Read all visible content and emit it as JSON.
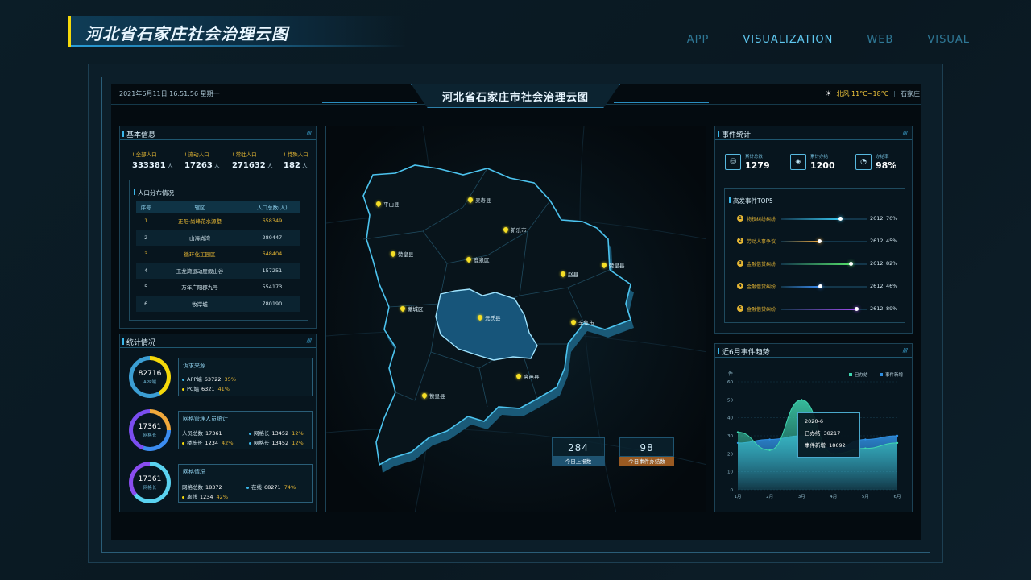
{
  "header": {
    "title": "河北省石家庄社会治理云图",
    "nav": [
      "APP",
      "VISUALIZATION",
      "WEB",
      "VISUAL"
    ],
    "active_nav": "VISUALIZATION"
  },
  "screen": {
    "datetime": "2021年6月11日  16:51:56   星期一",
    "title": "河北省石家庄市社会治理云图",
    "weather": "北风 11°C~18°C",
    "city": "石家庄"
  },
  "basic_info": {
    "title": "基本信息",
    "stats": [
      {
        "label": "全部人口",
        "value": "333381",
        "unit": "人"
      },
      {
        "label": "流动人口",
        "value": "17263",
        "unit": "人"
      },
      {
        "label": "常驻人口",
        "value": "271632",
        "unit": "人"
      },
      {
        "label": "特殊人口",
        "value": "182",
        "unit": "人"
      }
    ],
    "distribution": {
      "title": "人口分布情况",
      "headers": [
        "序号",
        "辖区",
        "人口总数(人)"
      ],
      "rows": [
        [
          "1",
          "正阳·尚峰花水源墅",
          "658349"
        ],
        [
          "2",
          "山海尚湾",
          "280447"
        ],
        [
          "3",
          "循环化工园区",
          "648404"
        ],
        [
          "4",
          "玉龙湾运动度假山谷",
          "157251"
        ],
        [
          "5",
          "万年广阳郡九号",
          "554173"
        ],
        [
          "6",
          "牧岸城",
          "780190"
        ]
      ]
    }
  },
  "stats_panel": {
    "title": "统计情况",
    "groups": [
      {
        "ring_value": "82716",
        "ring_label": "APP端",
        "box_title": "诉求来源",
        "lines": [
          {
            "label": "APP端",
            "value": "63722",
            "pct": "35%"
          },
          {
            "label": "PC端",
            "value": "6321",
            "pct": "41%"
          }
        ]
      },
      {
        "ring_value": "17361",
        "ring_label": "网格长",
        "box_title": "网格管理人员统计",
        "lines": [
          {
            "label": "人员总数",
            "value": "17361",
            "pct": ""
          },
          {
            "label": "网格长",
            "value": "13452",
            "pct": "12%"
          },
          {
            "label": "楼栋长",
            "value": "1234",
            "pct": "42%"
          },
          {
            "label": "网格长",
            "value": "13452",
            "pct": "12%"
          }
        ]
      },
      {
        "ring_value": "17361",
        "ring_label": "网格长",
        "box_title": "网格情况",
        "lines": [
          {
            "label": "网格总数",
            "value": "18372",
            "pct": ""
          },
          {
            "label": "在线",
            "value": "68271",
            "pct": "74%"
          },
          {
            "label": "离线",
            "value": "1234",
            "pct": "42%"
          }
        ]
      }
    ]
  },
  "map": {
    "pins": [
      "平山县",
      "灵寿县",
      "新乐市",
      "赞皇县",
      "鹿泉区",
      "赵县",
      "赞皇县",
      "藁城区",
      "元氏县",
      "辛集市",
      "高邑县",
      "赞皇县"
    ],
    "kpis": [
      {
        "value": "284",
        "label": "今日上报数"
      },
      {
        "value": "98",
        "label": "今日事件办结数"
      }
    ]
  },
  "events": {
    "title": "事件统计",
    "summary": [
      {
        "icon": "database-icon",
        "label": "累计总数",
        "value": "1279"
      },
      {
        "icon": "layers-icon",
        "label": "累计办结",
        "value": "1200"
      },
      {
        "icon": "gauge-icon",
        "label": "办结率",
        "value": "98%"
      }
    ],
    "top5_title": "高发事件TOP5",
    "top5": [
      {
        "rank": "1",
        "name": "物权纠纷纠纷",
        "count": "2612",
        "pct": "70%",
        "ratio": 0.7,
        "color": "#38c6f0"
      },
      {
        "rank": "2",
        "name": "劳动人事争议",
        "count": "2612",
        "pct": "45%",
        "ratio": 0.45,
        "color": "#f0a83c"
      },
      {
        "rank": "3",
        "name": "金融借贷纠纷",
        "count": "2612",
        "pct": "82%",
        "ratio": 0.82,
        "color": "#54e06a"
      },
      {
        "rank": "4",
        "name": "金融借贷纠纷",
        "count": "2612",
        "pct": "46%",
        "ratio": 0.46,
        "color": "#3b8cf0"
      },
      {
        "rank": "5",
        "name": "金融借贷纠纷",
        "count": "2612",
        "pct": "89%",
        "ratio": 0.89,
        "color": "#a24df0"
      }
    ]
  },
  "trend": {
    "title": "近6月事件趋势",
    "tooltip": {
      "month": "2020-6",
      "line1_label": "已办结",
      "line1_value": "38217",
      "line2_label": "事件新增",
      "line2_value": "18692"
    }
  },
  "chart_data": {
    "type": "area",
    "ylabel": "件",
    "ylim": [
      0,
      60
    ],
    "yticks": [
      0,
      10,
      20,
      30,
      40,
      50,
      60
    ],
    "x": [
      "1月",
      "2月",
      "3月",
      "4月",
      "5月",
      "6月"
    ],
    "series": [
      {
        "name": "已办结",
        "values": [
          32,
          22,
          50,
          20,
          23,
          26
        ],
        "color": "#3fd6b0"
      },
      {
        "name": "事件新增",
        "values": [
          26,
          28,
          30,
          23,
          28,
          30
        ],
        "color": "#2f8ee0"
      }
    ]
  }
}
